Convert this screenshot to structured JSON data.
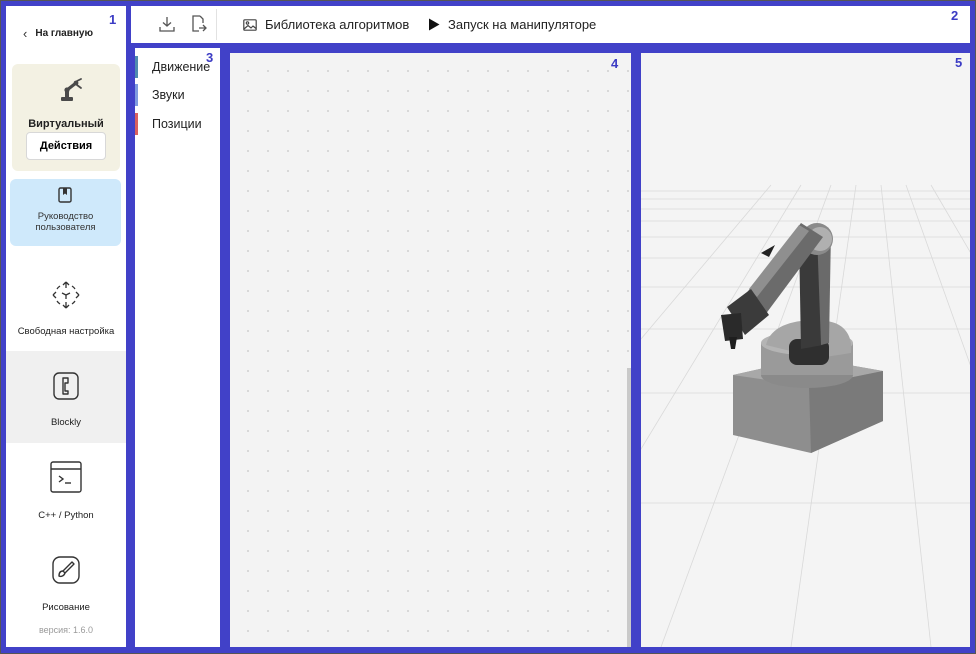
{
  "panel_numbers": {
    "sidebar": "1",
    "toolbar": "2",
    "palette": "3",
    "workspace": "4",
    "viewer": "5"
  },
  "sidebar": {
    "back_label": "На главную",
    "mode_card": {
      "title": "Виртуальный",
      "actions_label": "Действия",
      "icon": "robot-arm-icon"
    },
    "guide": {
      "line1": "Руководство",
      "line2": "пользователя",
      "icon": "book-icon"
    },
    "nav": [
      {
        "label": "Свободная настройка",
        "icon": "free-move-icon",
        "active": false
      },
      {
        "label": "Blockly",
        "icon": "blockly-icon",
        "active": true
      },
      {
        "label": "C++ / Python",
        "icon": "terminal-icon",
        "active": false
      },
      {
        "label": "Рисование",
        "icon": "brush-icon",
        "active": false
      }
    ],
    "version": "версия: 1.6.0"
  },
  "toolbar": {
    "download_icon": "download-icon",
    "export_icon": "export-icon",
    "library_label": "Библиотека алгоритмов",
    "run_label": "Запуск на манипуляторе"
  },
  "palette": {
    "categories": [
      {
        "label": "Движение",
        "color": "#4f8bb0"
      },
      {
        "label": "Звуки",
        "color": "#7f9be0"
      },
      {
        "label": "Позиции",
        "color": "#d96060"
      }
    ]
  },
  "colors": {
    "frame": "#4141c8",
    "panel_number": "#3b3bc4",
    "mode_card_bg": "#f3f1e3",
    "guide_bg": "#cfe9fb",
    "active_nav_bg": "#f0f0f0"
  }
}
